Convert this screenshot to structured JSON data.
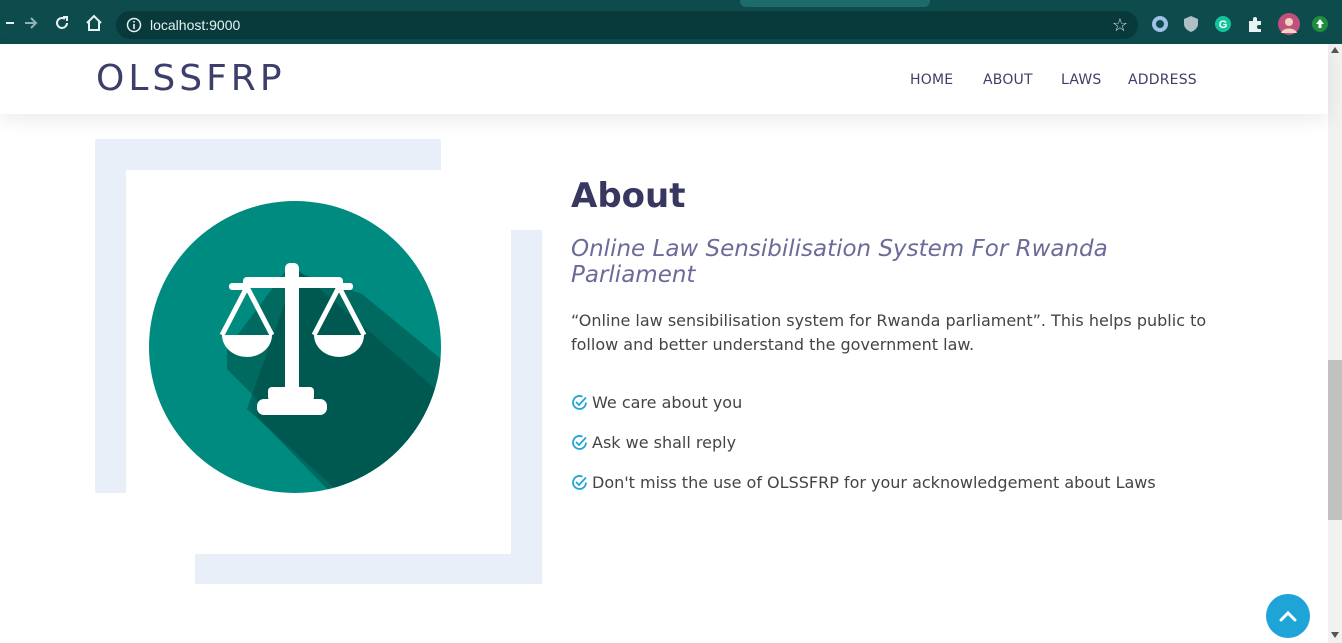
{
  "browser": {
    "url": "localhost:9000",
    "icons": [
      "back-icon",
      "forward-icon",
      "reload-icon",
      "home-icon",
      "info-icon",
      "bookmark-star-icon",
      "extension-icon",
      "shield-icon",
      "grammarly-icon",
      "puzzle-icon",
      "profile-avatar",
      "update-icon"
    ]
  },
  "header": {
    "logo": "OLSSFRP",
    "nav": [
      "HOME",
      "ABOUT",
      "LAWS",
      "ADDRESS"
    ]
  },
  "about": {
    "title": "About",
    "subtitle": "Online Law Sensibilisation System For Rwanda Parliament",
    "description": "“Online law sensibilisation system for Rwanda parliament”. This helps public to follow and better understand the government law.",
    "bullets": [
      "We care about you",
      "Ask we shall reply",
      "Don't miss the use of OLSSFRP for your acknowledgement about Laws"
    ]
  },
  "colors": {
    "browser_bg": "#0d4b4d",
    "accent_teal": "#008b80",
    "heading": "#37375f",
    "subtitle": "#6a6b98",
    "check": "#1ea4d7",
    "frame": "#e8eff8"
  }
}
